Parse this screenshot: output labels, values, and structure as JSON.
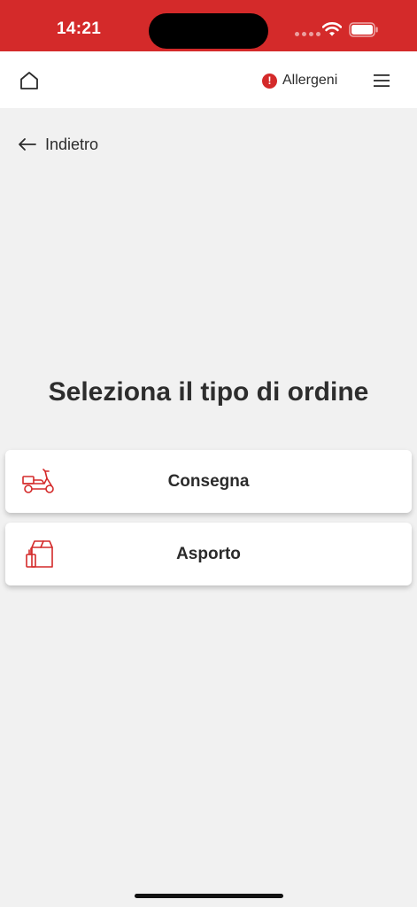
{
  "status_bar": {
    "time": "14:21",
    "background_color": "#d42a2a"
  },
  "header": {
    "home_icon": "home-icon",
    "allergens_label": "Allergeni",
    "alert_glyph": "!",
    "menu_icon": "hamburger-menu-icon"
  },
  "back": {
    "label": "Indietro"
  },
  "main": {
    "title": "Seleziona il tipo di ordine",
    "options": [
      {
        "label": "Consegna",
        "icon": "scooter-icon"
      },
      {
        "label": "Asporto",
        "icon": "takeaway-bag-icon"
      }
    ]
  },
  "colors": {
    "accent": "#d42a2a",
    "background": "#f1f1f1",
    "text": "#2b2b2b"
  }
}
